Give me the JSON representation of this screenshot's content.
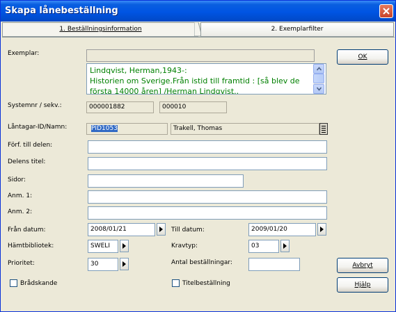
{
  "window": {
    "title": "Skapa lånebeställning"
  },
  "tabs": [
    {
      "label": "1. Beställningsinformation"
    },
    {
      "label": "2. Exemplarfilter"
    }
  ],
  "labels": {
    "exemplar": "Exemplar:",
    "systemnr": "Systemnr / sekv.:",
    "lantagare": "Låntagar-ID/Namn:",
    "forf": "Förf. till delen:",
    "delens_titel": "Delens titel:",
    "sidor": "Sidor:",
    "anm1": "Anm. 1:",
    "anm2": "Anm. 2:",
    "fran_datum": "Från datum:",
    "till_datum": "Till datum:",
    "hamtbibliotek": "Hämtbibliotek:",
    "kravtyp": "Kravtyp:",
    "prioritet": "Prioritet:",
    "antal": "Antal beställningar:",
    "bradskande": "Brådskande",
    "titelbestallning": "Titelbeställning"
  },
  "fields": {
    "exemplar_top": "",
    "exemplar_lines": [
      "Lindqvist, Herman,1943-:",
      "Historien om Sverige.Från istid till framtid : [så blev de",
      "första 14000 åren] /Herman Lindqvist.."
    ],
    "systemnr": "000001882",
    "sekv": "000010",
    "lantagare_id": "PID1053",
    "lantagare_namn": "Trakell, Thomas",
    "forf": "",
    "delens_titel": "",
    "sidor": "",
    "anm1": "",
    "anm2": "",
    "fran_datum": "2008/01/21",
    "till_datum": "2009/01/20",
    "hamtbibliotek": "SWELI",
    "kravtyp": "03",
    "prioritet": "30",
    "antal": ""
  },
  "buttons": {
    "ok": "OK",
    "avbryt": "Avbryt",
    "hjalp": "Hjälp"
  }
}
